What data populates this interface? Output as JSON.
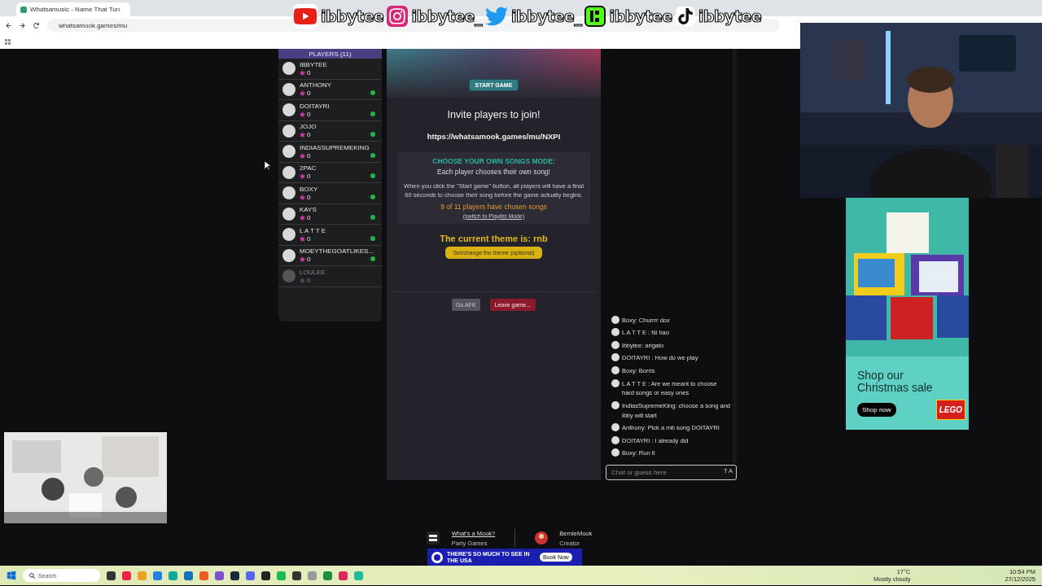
{
  "browser": {
    "tab_title": "Whatsamusic - Name That Tun",
    "url": "whatsamook.games/mu"
  },
  "overlay_socials": [
    {
      "kind": "youtube",
      "handle": "ibbytee"
    },
    {
      "kind": "instagram",
      "handle": "ibbytee_"
    },
    {
      "kind": "twitter",
      "handle": "ibbytee_"
    },
    {
      "kind": "kick",
      "handle": "ibbytee"
    },
    {
      "kind": "tiktok",
      "handle": "ibbytee"
    }
  ],
  "players": {
    "title": "PLAYERS (11)",
    "items": [
      {
        "name": "IBBYTEE",
        "score": "0",
        "ready": false,
        "disabled": false
      },
      {
        "name": "ANTHONY",
        "score": "0",
        "ready": true,
        "disabled": false
      },
      {
        "name": "DOITAYRI",
        "score": "0",
        "ready": true,
        "disabled": false
      },
      {
        "name": "JOJO",
        "score": "0",
        "ready": true,
        "disabled": false
      },
      {
        "name": "INDIASSUPREMEKING",
        "score": "0",
        "ready": true,
        "disabled": false
      },
      {
        "name": "2PAC",
        "score": "0",
        "ready": true,
        "disabled": false
      },
      {
        "name": "BOXY",
        "score": "0",
        "ready": true,
        "disabled": false
      },
      {
        "name": "KAYS",
        "score": "0",
        "ready": true,
        "disabled": false
      },
      {
        "name": "L A T T E",
        "score": "0",
        "ready": true,
        "disabled": false
      },
      {
        "name": "MOEYTHEGOATLIKES...",
        "score": "0",
        "ready": true,
        "disabled": false
      },
      {
        "name": "LOULEE",
        "score": "0",
        "ready": false,
        "disabled": true
      }
    ]
  },
  "game": {
    "start_button": "START GAME",
    "invite_title": "Invite players to join!",
    "invite_url": "https://whatsamook.games/mu/NXPI",
    "mode_title": "CHOOSE YOUR OWN SONGS MODE:",
    "mode_subtitle": "Each player chooses their own song!",
    "mode_description": "When you click the \"Start game\" button, all players will have a final 60 seconds to choose their song before the game actually begins.",
    "chosen_status": "9 of 11 players have chosen songs",
    "switch_link": "(switch to Playlist Mode)",
    "theme_text": "The current theme is: rnb",
    "theme_button": "Set/change the theme (optional)",
    "afk_button": "Go AFK",
    "leave_button": "Leave game..."
  },
  "chat": {
    "messages": [
      {
        "text": "Boxy: Churrrr dox"
      },
      {
        "text": "L A T T E : Ni hao"
      },
      {
        "text": "ibbytee: arigato"
      },
      {
        "text": "DOITAYRI : How do we play"
      },
      {
        "text": "Boxy: Borris"
      },
      {
        "text": "L A T T E : Are we meant to choose hard songs or easy ones"
      },
      {
        "text": "IndiasSupremeKing: choose a song and ibby will start"
      },
      {
        "text": "Anthony: Pick a rnb song DOITAYRI"
      },
      {
        "text": "DOITAYRI : I already did"
      },
      {
        "text": "Boxy: Run it"
      }
    ],
    "placeholder": "Chat or guess here",
    "input_suffix": "T A"
  },
  "ad": {
    "headline": "Shop our Christmas sale",
    "button": "Shop now",
    "brand": "LEGO"
  },
  "footer": {
    "site_title": "What's a Mook?",
    "site_subtitle": "Party Games",
    "creator_name": "BernieMook",
    "creator_role": "Creator",
    "banner_text": "THERE'S SO MUCH TO SEE IN THE USA",
    "banner_button": "Book Now"
  },
  "taskbar": {
    "search_placeholder": "Search",
    "weather_temp": "17°C",
    "weather_text": "Mostly cloudy",
    "time": "10:54 PM",
    "date": "27/12/2025"
  }
}
